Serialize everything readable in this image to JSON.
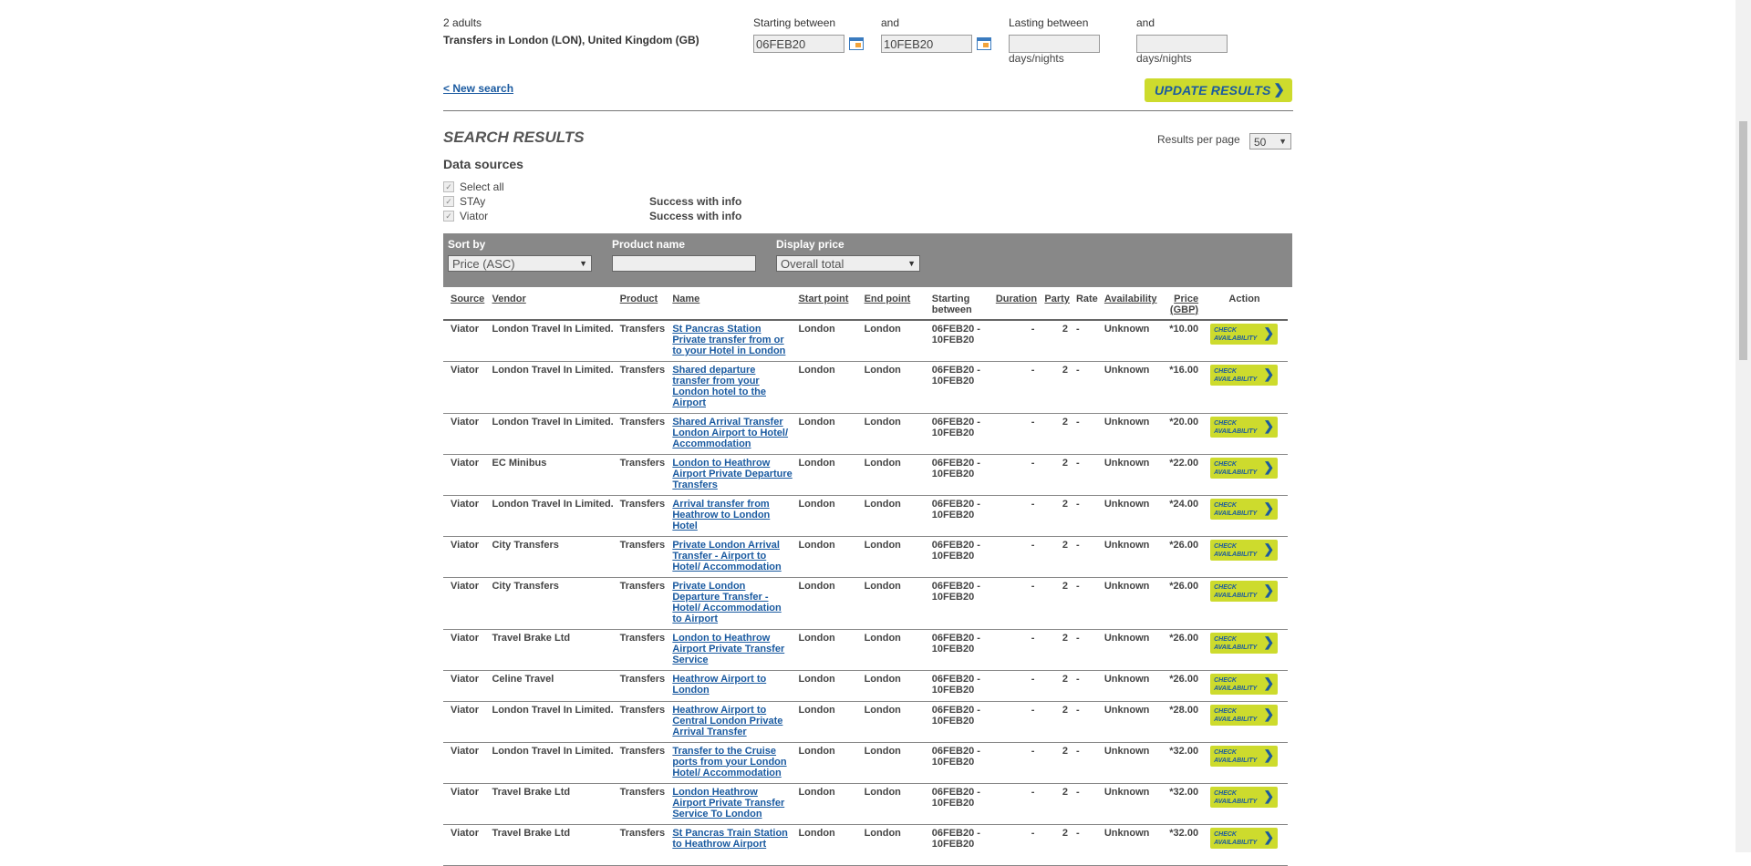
{
  "search": {
    "adults": "2 adults",
    "destination": "Transfers in London (LON), United Kingdom (GB)",
    "start_label": "Starting between",
    "and1": "and",
    "start_from": "06FEB20",
    "start_to": "10FEB20",
    "lasting_label": "Lasting between",
    "and2": "and",
    "lasting_from": "",
    "lasting_to": "",
    "days_nights_1": "days/nights",
    "days_nights_2": "days/nights",
    "new_search": "< New search",
    "update_label": "UPDATE RESULTS"
  },
  "results": {
    "title": "SEARCH RESULTS",
    "per_page_label": "Results per page",
    "per_page_value": "50"
  },
  "data_sources": {
    "title": "Data sources",
    "select_all": "Select all",
    "items": [
      {
        "name": "STAy",
        "status": "Success with info"
      },
      {
        "name": "Viator",
        "status": "Success with info"
      }
    ]
  },
  "filters": {
    "sort_label": "Sort by",
    "sort_value": "Price (ASC)",
    "product_label": "Product name",
    "product_value": "",
    "display_label": "Display price",
    "display_value": "Overall total"
  },
  "table": {
    "headers": {
      "source": "Source",
      "vendor": "Vendor",
      "product": "Product",
      "name": "Name",
      "start": "Start point",
      "end": "End point",
      "starting": "Starting between",
      "duration": "Duration",
      "party": "Party",
      "rate": "Rate",
      "availability": "Availability",
      "price": "Price (GBP)",
      "action": "Action"
    },
    "check_label": "CHECK AVAILABILITY",
    "rows": [
      {
        "source": "Viator",
        "vendor": "London Travel In Limited.",
        "product": "Transfers",
        "name": "St Pancras Station Private transfer from or to your Hotel in London",
        "start": "London",
        "end": "London",
        "starting": "06FEB20 - 10FEB20",
        "duration": "-",
        "party": "2",
        "rate": "-",
        "availability": "Unknown",
        "price": "*10.00"
      },
      {
        "source": "Viator",
        "vendor": "London Travel In Limited.",
        "product": "Transfers",
        "name": "Shared departure transfer from your London hotel to the Airport",
        "start": "London",
        "end": "London",
        "starting": "06FEB20 - 10FEB20",
        "duration": "-",
        "party": "2",
        "rate": "-",
        "availability": "Unknown",
        "price": "*16.00"
      },
      {
        "source": "Viator",
        "vendor": "London Travel In Limited.",
        "product": "Transfers",
        "name": "Shared Arrival Transfer London Airport to Hotel/ Accommodation",
        "start": "London",
        "end": "London",
        "starting": "06FEB20 - 10FEB20",
        "duration": "-",
        "party": "2",
        "rate": "-",
        "availability": "Unknown",
        "price": "*20.00"
      },
      {
        "source": "Viator",
        "vendor": "EC Minibus",
        "product": "Transfers",
        "name": "London to Heathrow Airport Private Departure Transfers",
        "start": "London",
        "end": "London",
        "starting": "06FEB20 - 10FEB20",
        "duration": "-",
        "party": "2",
        "rate": "-",
        "availability": "Unknown",
        "price": "*22.00"
      },
      {
        "source": "Viator",
        "vendor": "London Travel In Limited.",
        "product": "Transfers",
        "name": "Arrival transfer from Heathrow to London Hotel",
        "start": "London",
        "end": "London",
        "starting": "06FEB20 - 10FEB20",
        "duration": "-",
        "party": "2",
        "rate": "-",
        "availability": "Unknown",
        "price": "*24.00"
      },
      {
        "source": "Viator",
        "vendor": "City Transfers",
        "product": "Transfers",
        "name": "Private London Arrival Transfer - Airport to Hotel/ Accommodation",
        "start": "London",
        "end": "London",
        "starting": "06FEB20 - 10FEB20",
        "duration": "-",
        "party": "2",
        "rate": "-",
        "availability": "Unknown",
        "price": "*26.00"
      },
      {
        "source": "Viator",
        "vendor": "City Transfers",
        "product": "Transfers",
        "name": "Private London Departure Transfer - Hotel/ Accommodation to Airport",
        "start": "London",
        "end": "London",
        "starting": "06FEB20 - 10FEB20",
        "duration": "-",
        "party": "2",
        "rate": "-",
        "availability": "Unknown",
        "price": "*26.00"
      },
      {
        "source": "Viator",
        "vendor": "Travel Brake Ltd",
        "product": "Transfers",
        "name": "London to Heathrow Airport Private Transfer Service",
        "start": "London",
        "end": "London",
        "starting": "06FEB20 - 10FEB20",
        "duration": "-",
        "party": "2",
        "rate": "-",
        "availability": "Unknown",
        "price": "*26.00"
      },
      {
        "source": "Viator",
        "vendor": "Celine Travel",
        "product": "Transfers",
        "name": "Heathrow Airport to London",
        "start": "London",
        "end": "London",
        "starting": "06FEB20 - 10FEB20",
        "duration": "-",
        "party": "2",
        "rate": "-",
        "availability": "Unknown",
        "price": "*26.00"
      },
      {
        "source": "Viator",
        "vendor": "London Travel In Limited.",
        "product": "Transfers",
        "name": "Heathrow Airport to Central London Private Arrival Transfer",
        "start": "London",
        "end": "London",
        "starting": "06FEB20 - 10FEB20",
        "duration": "-",
        "party": "2",
        "rate": "-",
        "availability": "Unknown",
        "price": "*28.00"
      },
      {
        "source": "Viator",
        "vendor": "London Travel In Limited.",
        "product": "Transfers",
        "name": "Transfer to the Cruise ports from your London Hotel/ Accommodation",
        "start": "London",
        "end": "London",
        "starting": "06FEB20 - 10FEB20",
        "duration": "-",
        "party": "2",
        "rate": "-",
        "availability": "Unknown",
        "price": "*32.00"
      },
      {
        "source": "Viator",
        "vendor": "Travel Brake Ltd",
        "product": "Transfers",
        "name": "London Heathrow Airport Private Transfer Service To London",
        "start": "London",
        "end": "London",
        "starting": "06FEB20 - 10FEB20",
        "duration": "-",
        "party": "2",
        "rate": "-",
        "availability": "Unknown",
        "price": "*32.00"
      },
      {
        "source": "Viator",
        "vendor": "Travel Brake Ltd",
        "product": "Transfers",
        "name": "St Pancras Train Station to Heathrow Airport",
        "start": "London",
        "end": "London",
        "starting": "06FEB20 - 10FEB20",
        "duration": "-",
        "party": "2",
        "rate": "-",
        "availability": "Unknown",
        "price": "*32.00"
      }
    ]
  }
}
